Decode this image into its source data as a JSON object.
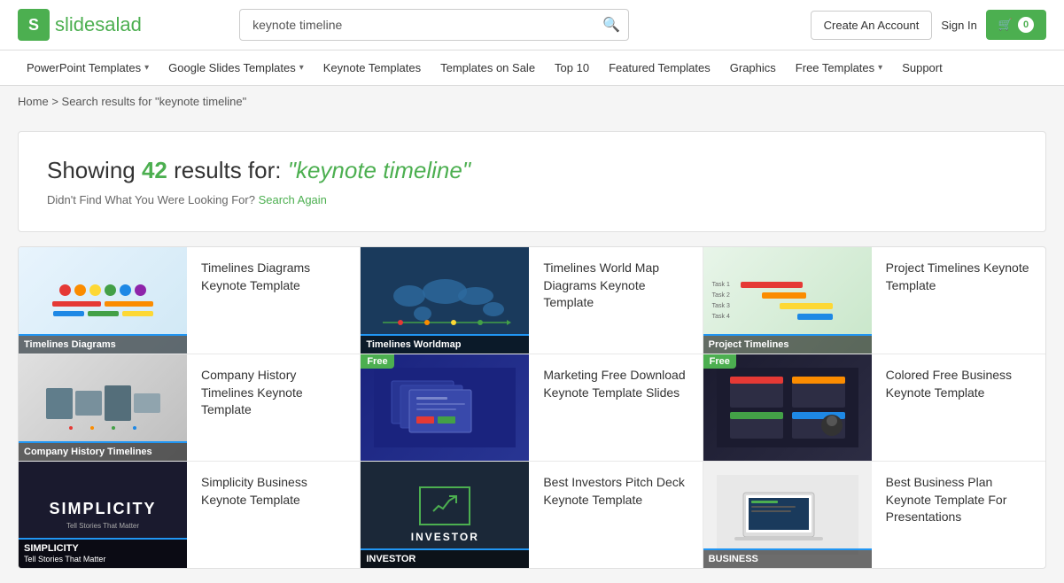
{
  "header": {
    "logo_text_1": "slide",
    "logo_text_2": "salad",
    "logo_letter": "S",
    "search_placeholder": "keynote timeline",
    "search_value": "keynote timeline",
    "btn_create": "Create An Account",
    "btn_signin": "Sign In",
    "cart_icon": "🛒",
    "cart_count": "0"
  },
  "nav": {
    "items": [
      {
        "label": "PowerPoint Templates",
        "has_arrow": true,
        "id": "powerpoint"
      },
      {
        "label": "Google Slides Templates",
        "has_arrow": true,
        "id": "google-slides"
      },
      {
        "label": "Keynote Templates",
        "has_arrow": false,
        "id": "keynote"
      },
      {
        "label": "Templates on Sale",
        "has_arrow": false,
        "id": "on-sale"
      },
      {
        "label": "Top 10",
        "has_arrow": false,
        "id": "top10"
      },
      {
        "label": "Featured Templates",
        "has_arrow": false,
        "id": "featured"
      },
      {
        "label": "Graphics",
        "has_arrow": false,
        "id": "graphics"
      },
      {
        "label": "Free Templates",
        "has_arrow": true,
        "id": "free"
      },
      {
        "label": "Support",
        "has_arrow": false,
        "id": "support"
      }
    ]
  },
  "breadcrumb": {
    "home": "Home",
    "separator": ">",
    "current": "Search results for \"keynote timeline\""
  },
  "results": {
    "prefix": "Showing ",
    "count": "42",
    "middle": " results for: ",
    "query": "\"keynote timeline\"",
    "not_found": "Didn't Find What You Were Looking For?",
    "search_again": "Search Again"
  },
  "cards": [
    {
      "id": "1",
      "title": "Timelines Diagrams Keynote Template",
      "thumb_label": "Timelines Diagrams",
      "thumb_type": "diagram",
      "is_free": false
    },
    {
      "id": "2",
      "title": "Timelines World Map Diagrams Keynote Template",
      "thumb_label": "Timelines Worldmap",
      "thumb_type": "worldmap",
      "is_free": false
    },
    {
      "id": "3",
      "title": "Project Timelines Keynote Template",
      "thumb_label": "Project Timelines",
      "thumb_type": "project",
      "is_free": false
    },
    {
      "id": "4",
      "title": "Company History Timelines Keynote Template",
      "thumb_label": "Company History Timelines",
      "thumb_type": "company",
      "is_free": false
    },
    {
      "id": "5",
      "title": "Marketing Free Download Keynote Template Slides",
      "thumb_label": "",
      "thumb_type": "marketing",
      "is_free": true
    },
    {
      "id": "6",
      "title": "Colored Free Business Keynote Template",
      "thumb_label": "",
      "thumb_type": "colored",
      "is_free": true
    },
    {
      "id": "7",
      "title": "Simplicity Business Keynote Template",
      "thumb_label": "SIMPLICITY\nTell Stories That Matter",
      "thumb_type": "simplicity",
      "is_free": false
    },
    {
      "id": "8",
      "title": "Best Investors Pitch Deck Keynote Template",
      "thumb_label": "INVESTOR",
      "thumb_type": "investor",
      "is_free": false
    },
    {
      "id": "9",
      "title": "Best Business Plan Keynote Template For Presentations",
      "thumb_label": "BUSINESS",
      "thumb_type": "business",
      "is_free": false
    }
  ]
}
